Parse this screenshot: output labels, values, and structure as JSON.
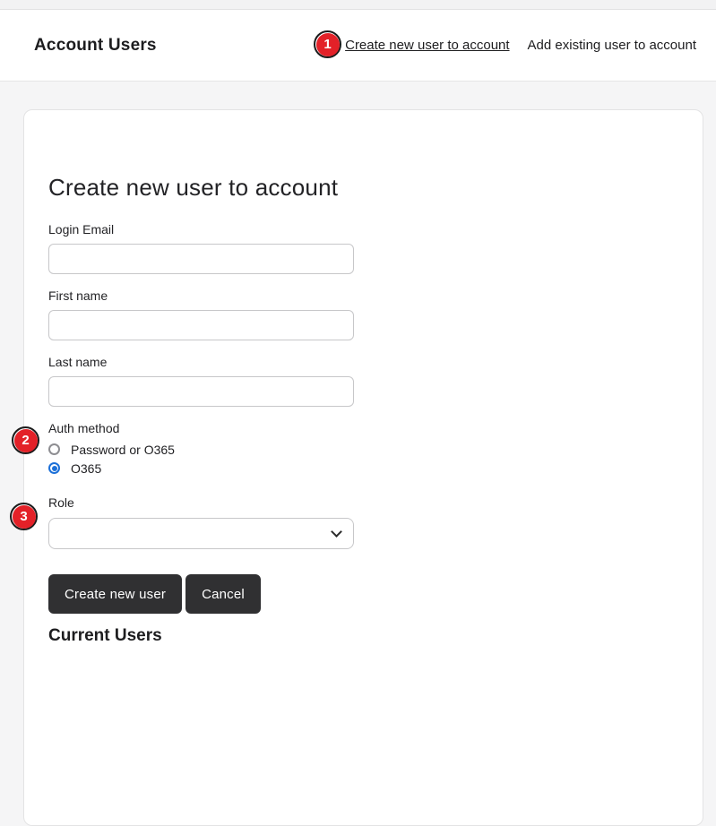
{
  "colors": {
    "accent_red": "#e32128",
    "radio_blue": "#1c70d8",
    "button_dark": "#303032",
    "page_bg": "#f5f5f6"
  },
  "header": {
    "title": "Account Users",
    "links": [
      {
        "label": "Create new user to account",
        "underlined": true
      },
      {
        "label": "Add existing user to account",
        "underlined": false
      }
    ]
  },
  "markers": [
    {
      "n": "1"
    },
    {
      "n": "2"
    },
    {
      "n": "3"
    }
  ],
  "form": {
    "heading": "Create new user to account",
    "fields": [
      {
        "label": "Login Email",
        "value": ""
      },
      {
        "label": "First name",
        "value": ""
      },
      {
        "label": "Last name",
        "value": ""
      }
    ],
    "auth": {
      "label": "Auth method",
      "options": [
        {
          "label": "Password or O365",
          "selected": false
        },
        {
          "label": "O365",
          "selected": true
        }
      ]
    },
    "role": {
      "label": "Role",
      "value": "",
      "icon": "chevron-down"
    },
    "buttons": {
      "submit": "Create new user",
      "cancel": "Cancel"
    }
  },
  "below_section": {
    "heading": "Current Users"
  }
}
